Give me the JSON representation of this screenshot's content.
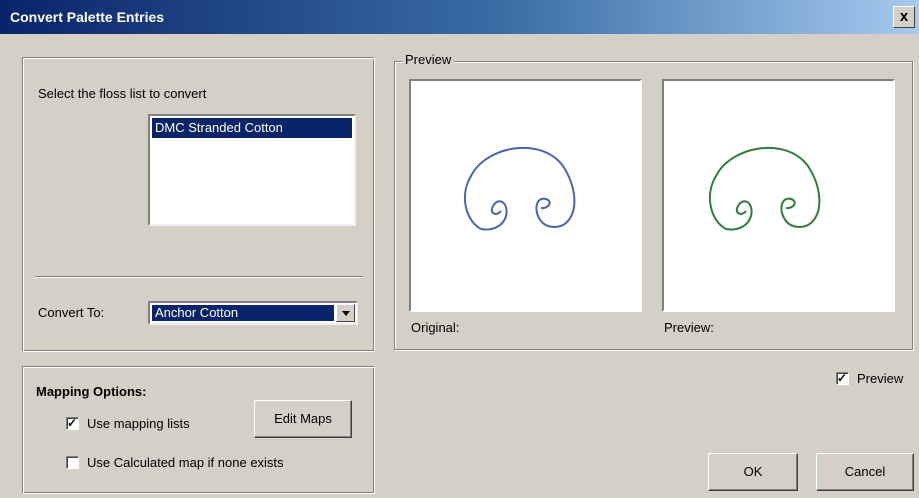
{
  "window": {
    "title": "Convert Palette Entries",
    "close_label": "x"
  },
  "source": {
    "prompt": "Select the floss list to convert",
    "list_items": [
      "DMC Stranded Cotton"
    ]
  },
  "convert": {
    "label": "Convert To:",
    "selected": "Anchor Cotton"
  },
  "mapping": {
    "title": "Mapping Options:",
    "use_mapping_lists_label": "Use mapping lists",
    "use_mapping_lists_checked": true,
    "use_calculated_label": "Use Calculated map if none exists",
    "use_calculated_checked": false,
    "edit_maps_label": "Edit Maps"
  },
  "preview": {
    "group_title": "Preview",
    "original_label": "Original:",
    "preview_label": "Preview:",
    "toggle_label": "Preview",
    "toggle_checked": true,
    "original_color": "#4a64b0",
    "preview_color": "#2e7d3c"
  },
  "buttons": {
    "ok_label": "OK",
    "cancel_label": "Cancel"
  },
  "icons": {
    "check": "✓",
    "close": "close-icon",
    "dropdown": "chevron-down-icon"
  }
}
